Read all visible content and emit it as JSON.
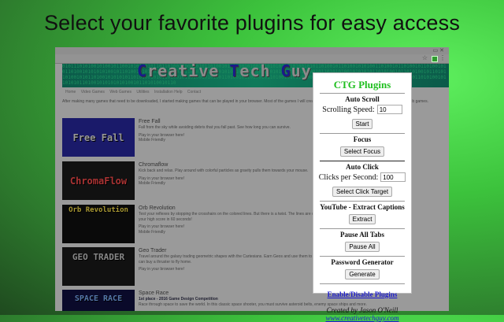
{
  "headline": "Select your favorite plugins for easy access",
  "site": {
    "logo": [
      "C",
      "reative ",
      "T",
      "ech ",
      "G",
      "uy"
    ],
    "banner_bits": "0101110101001010010110010101001011011010011000101011010010101100101001110101011010100101011010010110100101010011010010110100101101001010110100101010101001011010010101101001010010110101001011010101101001010101010100101101010010110101010010101010110101001011010100101101011010010101101001010101011010100101011010010110100101010011010010110100101101001010110100101010101001011010010101101001010010110101001011010101101001010101010100101101010010110",
    "nav": [
      "Home",
      "Video Games",
      "Web Games",
      "Utilities",
      "Installation Help",
      "Contact"
    ],
    "intro": "After making many games that need to be downloaded, I started making games that can be played in your browser. Most of the games I will create in the future will be web games, as I prefer making web games.",
    "games": [
      {
        "thumb": "Free Fall",
        "title": "Free Fall",
        "desc": "Fall from the sky while avoiding debris that you fall past. See how long you can survive.",
        "play": "Play in your browser here!",
        "mobile": "Mobile Friendly"
      },
      {
        "thumb": "ChromaFlow",
        "title": "Chromaflow",
        "desc": "Kick back and relax. Play around with colorful particles as gravity pulls them towards your mouse.",
        "play": "Play in your browser here!",
        "mobile": "Mobile Friendly"
      },
      {
        "thumb": "Orb Revolution",
        "title": "Orb Revolution",
        "desc": "Test your reflexes by stopping the crosshairs on the colored lines. But there is a twist. The lines are on a 3D orb in space. Try for your high score in 60 seconds!",
        "play": "Play in your browser here!",
        "mobile": "Mobile Friendly"
      },
      {
        "thumb": "GEO TRADER",
        "title": "Geo Trader",
        "desc": "Travel around the galaxy trading geometric shapes with the Cartesians. Earn Geos and use them to upgrade your ship. Geos you can buy a thruster to fly home.",
        "play": "Play in your browser here!",
        "mobile": ""
      },
      {
        "thumb": "SPACE RACE",
        "title": "Space Race",
        "award": "1st place - 2016 Game Design Competition",
        "desc": "Race through space to save the world. In this classic space shooter, you must survive asteroid belts, enemy space ships and more.",
        "play": "",
        "mobile": ""
      }
    ]
  },
  "popup": {
    "title": "CTG Plugins",
    "auto_scroll": {
      "heading": "Auto Scroll",
      "label": "Scrolling Speed:",
      "value": "10",
      "button": "Start"
    },
    "focus": {
      "heading": "Focus",
      "button": "Select Focus"
    },
    "auto_click": {
      "heading": "Auto Click",
      "label": "Clicks per Second:",
      "value": "100",
      "button": "Select Click Target"
    },
    "youtube": {
      "heading": "YouTube - Extract Captions",
      "button": "Extract"
    },
    "pause": {
      "heading": "Pause All Tabs",
      "button": "Pause All"
    },
    "password": {
      "heading": "Password Generator",
      "button": "Generate"
    },
    "enable_link": "Enable/Disable Plugins",
    "credit": "Created by Jason O'Neill",
    "website": "www.creativetechguy.com"
  }
}
